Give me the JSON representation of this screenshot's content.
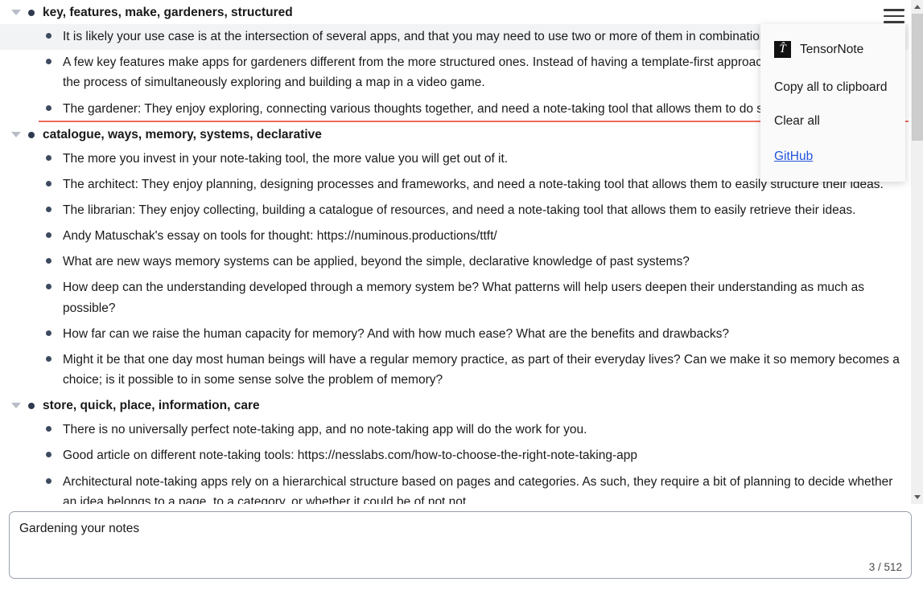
{
  "app": {
    "name": "TensorNote"
  },
  "menu": {
    "brand_label": "TensorNote",
    "logo_glyph": "T̂",
    "copy_label": "Copy all to clipboard",
    "clear_label": "Clear all",
    "github_label": "GitHub",
    "link_color": "#2255dd"
  },
  "composer": {
    "value": "Gardening your notes",
    "placeholder": "",
    "char_count": "3 / 512"
  },
  "notes": {
    "groups": [
      {
        "title": "key, features, make, gardeners, structured",
        "items": [
          {
            "text": "It is likely your use case is at the intersection of several apps, and that you may need to use two or more of them in combination to reach your goals.",
            "highlighted": true,
            "underlined": false
          },
          {
            "text": "A few key features make apps for gardeners different from the more structured ones. Instead of having a template-first approach, the process is akin to the process of simultaneously exploring and building a map in a video game.",
            "highlighted": false,
            "underlined": false
          },
          {
            "text": "The gardener: They enjoy exploring, connecting various thoughts together, and need a note-taking tool that allows them to do so.",
            "highlighted": false,
            "underlined": true
          }
        ]
      },
      {
        "title": "catalogue, ways, memory, systems, declarative",
        "items": [
          {
            "text": "The more you invest in your note-taking tool, the more value you will get out of it.",
            "highlighted": false,
            "underlined": false
          },
          {
            "text": "The architect: They enjoy planning, designing processes and frameworks, and need a note-taking tool that allows them to easily structure their ideas.",
            "highlighted": false,
            "underlined": false
          },
          {
            "text": "The librarian: They enjoy collecting, building a catalogue of resources, and need a note-taking tool that allows them to easily retrieve their ideas.",
            "highlighted": false,
            "underlined": false
          },
          {
            "text": "Andy Matuschak's essay on tools for thought: https://numinous.productions/ttft/",
            "highlighted": false,
            "underlined": false
          },
          {
            "text": "What are new ways memory systems can be applied, beyond the simple, declarative knowledge of past systems?",
            "highlighted": false,
            "underlined": false
          },
          {
            "text": "How deep can the understanding developed through a memory system be? What patterns will help users deepen their understanding as much as possible?",
            "highlighted": false,
            "underlined": false
          },
          {
            "text": "How far can we raise the human capacity for memory? And with how much ease? What are the benefits and drawbacks?",
            "highlighted": false,
            "underlined": false
          },
          {
            "text": "Might it be that one day most human beings will have a regular memory practice, as part of their everyday lives? Can we make it so memory becomes a choice; is it possible to in some sense solve the problem of memory?",
            "highlighted": false,
            "underlined": false
          }
        ]
      },
      {
        "title": "store, quick, place, information, care",
        "items": [
          {
            "text": "There is no universally perfect note-taking app, and no note-taking app will do the work for you.",
            "highlighted": false,
            "underlined": false
          },
          {
            "text": "Good article on different note-taking tools: https://nesslabs.com/how-to-choose-the-right-note-taking-app",
            "highlighted": false,
            "underlined": false
          },
          {
            "text": "Architectural note-taking apps rely on a hierarchical structure based on pages and categories. As such, they require a bit of planning to decide whether an idea belongs to a page, to a category, or whether it could be of not not.",
            "highlighted": false,
            "underlined": false
          }
        ]
      }
    ]
  }
}
